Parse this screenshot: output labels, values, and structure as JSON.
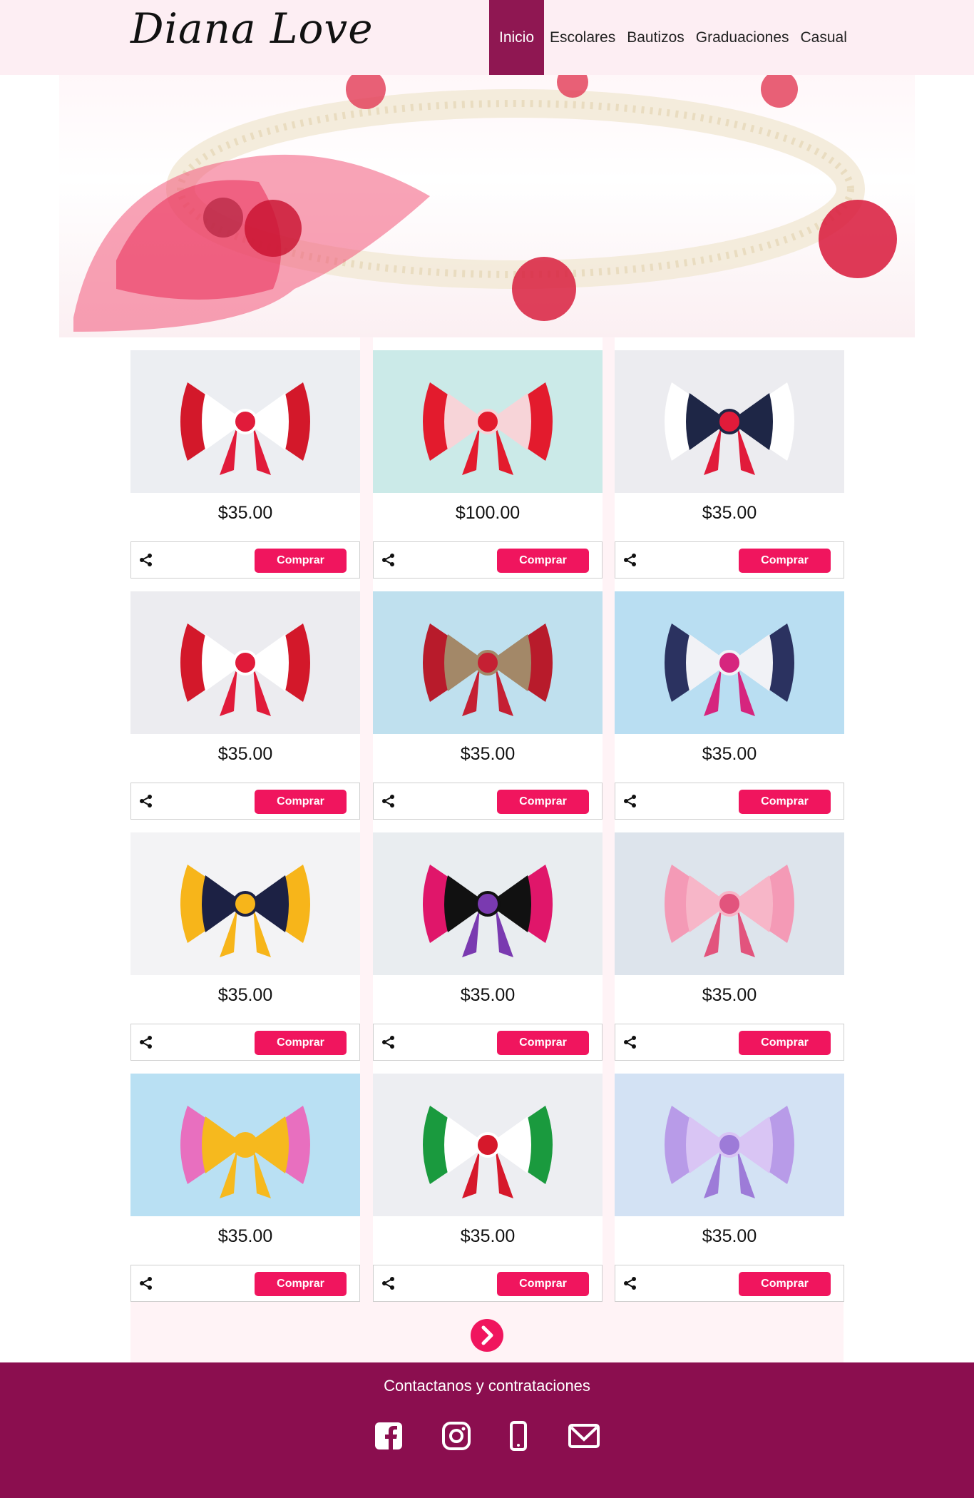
{
  "header": {
    "logo_text": "Diana Love",
    "nav": [
      {
        "label": "Inicio",
        "active": true
      },
      {
        "label": "Escolares",
        "active": false
      },
      {
        "label": "Bautizos",
        "active": false
      },
      {
        "label": "Graduaciones",
        "active": false
      },
      {
        "label": "Casual",
        "active": false
      }
    ]
  },
  "products": [
    {
      "price": "$35.00",
      "buy_label": "Comprar",
      "image": "red-white-hearts-bow"
    },
    {
      "price": "$100.00",
      "buy_label": "Comprar",
      "image": "flower-crown-red-bow"
    },
    {
      "price": "$35.00",
      "buy_label": "Comprar",
      "image": "hearts-navy-flower-bow"
    },
    {
      "price": "$35.00",
      "buy_label": "Comprar",
      "image": "red-white-stripes-bow"
    },
    {
      "price": "$35.00",
      "buy_label": "Comprar",
      "image": "kanzashi-flower-headband"
    },
    {
      "price": "$35.00",
      "buy_label": "Comprar",
      "image": "navy-pink-bow"
    },
    {
      "price": "$35.00",
      "buy_label": "Comprar",
      "image": "yellow-navy-bow"
    },
    {
      "price": "$35.00",
      "buy_label": "Comprar",
      "image": "day-of-dead-bow"
    },
    {
      "price": "$35.00",
      "buy_label": "Comprar",
      "image": "pink-princess-flower-bow"
    },
    {
      "price": "$35.00",
      "buy_label": "Comprar",
      "image": "pink-yellow-princess-bow"
    },
    {
      "price": "$35.00",
      "buy_label": "Comprar",
      "image": "mexican-flag-bow"
    },
    {
      "price": "$35.00",
      "buy_label": "Comprar",
      "image": "lilac-princess-bow"
    }
  ],
  "pagination": {
    "next_icon": "chevron-right-icon"
  },
  "footer": {
    "title": "Contactanos y contrataciones",
    "icons": [
      "facebook-icon",
      "instagram-icon",
      "phone-icon",
      "mail-icon"
    ]
  },
  "colors": {
    "brand": "#8b0e4f",
    "accent": "#f0155e",
    "header_bg": "#fdeef3",
    "grid_bg": "#fff3f6"
  }
}
